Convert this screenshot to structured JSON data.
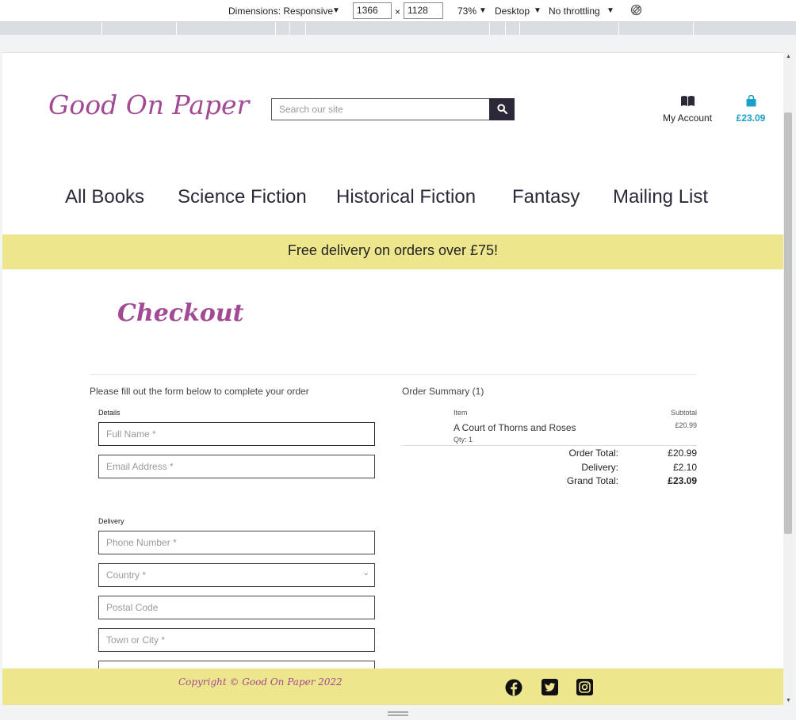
{
  "devtools": {
    "dimensions_label": "Dimensions: Responsive",
    "width": "1366",
    "times": "×",
    "height": "1128",
    "zoom": "73%",
    "device": "Desktop",
    "throttle": "No throttling"
  },
  "header": {
    "logo": "Good On Paper",
    "search_placeholder": "Search our site",
    "account_label": "My Account",
    "cart_total": "£23.09",
    "accent_color": "#a24a93",
    "cart_color": "#1aa0c8"
  },
  "nav": [
    "All Books",
    "Science Fiction",
    "Historical Fiction",
    "Fantasy",
    "Mailing List"
  ],
  "banner": "Free delivery on orders over £75!",
  "checkout": {
    "title": "Checkout",
    "instruction": "Please fill out the form below to complete your order",
    "details_label": "Details",
    "delivery_label": "Delivery",
    "fields": {
      "full_name": "Full Name *",
      "email": "Email Address *",
      "phone": "Phone Number *",
      "country": "Country *",
      "postal": "Postal Code",
      "town": "Town or City *"
    }
  },
  "summary": {
    "title": "Order Summary (1)",
    "item_header": "Item",
    "subtotal_header": "Subtotal",
    "item_title": "A Court of Thorns and Roses",
    "item_qty": "Qty: 1",
    "item_price": "£20.99",
    "order_total_label": "Order Total:",
    "order_total": "£20.99",
    "delivery_label": "Delivery:",
    "delivery": "£2.10",
    "grand_total_label": "Grand Total:",
    "grand_total": "£23.09"
  },
  "footer": {
    "copyright": "Copyright © Good On Paper 2022",
    "icons": [
      "facebook-icon",
      "twitter-icon",
      "instagram-icon"
    ]
  }
}
